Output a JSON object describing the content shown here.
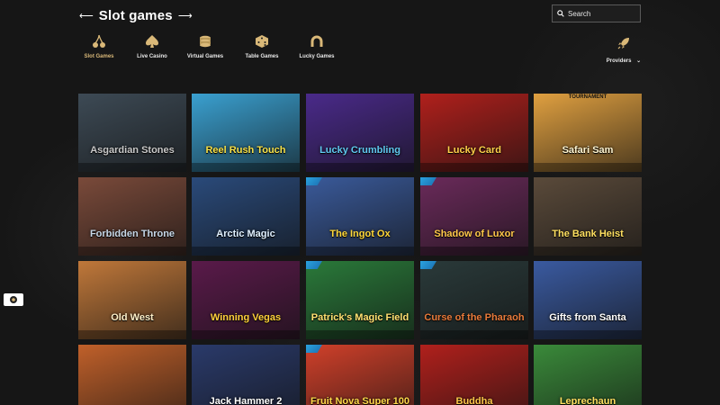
{
  "header": {
    "title": "Slot games",
    "search_placeholder": "Search"
  },
  "categories": [
    {
      "label": "Slot Games",
      "icon": "cherries-icon",
      "active": true
    },
    {
      "label": "Live Casino",
      "icon": "spade-icon",
      "active": false
    },
    {
      "label": "Virtual Games",
      "icon": "coin-stack-icon",
      "active": false
    },
    {
      "label": "Table Games",
      "icon": "dice-icon",
      "active": false
    },
    {
      "label": "Lucky Games",
      "icon": "horseshoe-icon",
      "active": false
    }
  ],
  "providers": {
    "label": "Providers",
    "icon": "rocket-icon"
  },
  "games": [
    {
      "name": "Asgardian Stones",
      "bg": "#3d4a55",
      "fg": "#c9c9c9"
    },
    {
      "name": "Reel Rush Touch",
      "bg": "#3aa0d0",
      "fg": "#f5e14a"
    },
    {
      "name": "Lucky Crumbling",
      "bg": "#4a2a8a",
      "fg": "#60c8f0"
    },
    {
      "name": "Lucky Card",
      "bg": "#b0201c",
      "fg": "#ffd04a"
    },
    {
      "name": "Safari Sam",
      "bg": "#e0a040",
      "fg": "#fff5d0",
      "tournament": "TOURNAMENT"
    },
    {
      "name": "Forbidden Throne",
      "bg": "#7a4a3a",
      "fg": "#c8d8e8"
    },
    {
      "name": "Arctic Magic",
      "bg": "#2a4a7a",
      "fg": "#e0f0ff"
    },
    {
      "name": "The Ingot Ox",
      "bg": "#3a5a9a",
      "fg": "#ffd83a",
      "badge": true
    },
    {
      "name": "Shadow of Luxor",
      "bg": "#6a2a5a",
      "fg": "#ffc84a",
      "badge": true
    },
    {
      "name": "The Bank Heist",
      "bg": "#5a4a3a",
      "fg": "#ffe060"
    },
    {
      "name": "Old West",
      "bg": "#c0783a",
      "fg": "#fff0c8"
    },
    {
      "name": "Winning Vegas",
      "bg": "#5a1a4a",
      "fg": "#ffd03a"
    },
    {
      "name": "Patrick's Magic Field",
      "bg": "#2a7a3a",
      "fg": "#ffe070",
      "badge": true
    },
    {
      "name": "Curse of the Pharaoh",
      "bg": "#2a3a3a",
      "fg": "#e87a3a",
      "badge": true
    },
    {
      "name": "Gifts from Santa",
      "bg": "#3a5aa0",
      "fg": "#ffffff"
    },
    {
      "name": "",
      "bg": "#c0602a",
      "fg": "#ffd040"
    },
    {
      "name": "Jack Hammer 2",
      "bg": "#2a3a6a",
      "fg": "#ffffff"
    },
    {
      "name": "Fruit Nova Super 100",
      "bg": "#d0402a",
      "fg": "#ffd84a",
      "badge": true
    },
    {
      "name": "Buddha",
      "bg": "#b0201c",
      "fg": "#ffc84a"
    },
    {
      "name": "Leprechaun",
      "bg": "#3a8a3a",
      "fg": "#ffe060"
    }
  ]
}
